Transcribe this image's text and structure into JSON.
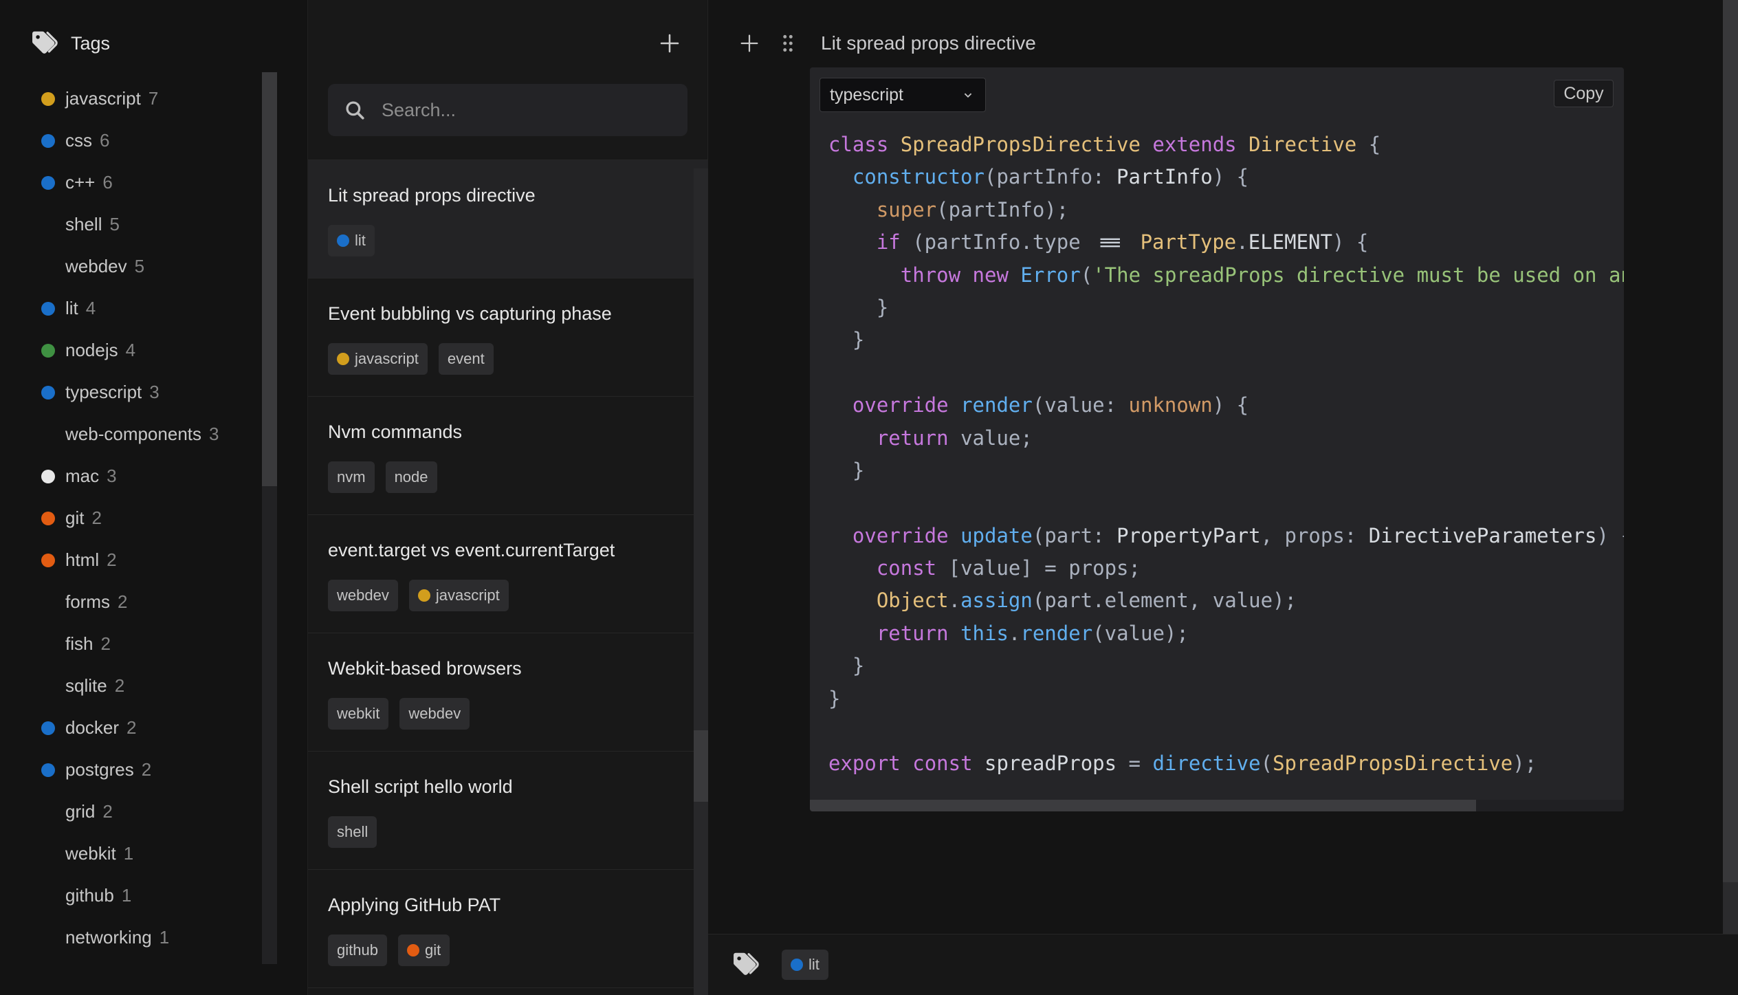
{
  "sidebar": {
    "title": "Tags",
    "tags": [
      {
        "label": "javascript",
        "count": "7",
        "dot": "yellow"
      },
      {
        "label": "css",
        "count": "6",
        "dot": "blue"
      },
      {
        "label": "c++",
        "count": "6",
        "dot": "blue"
      },
      {
        "label": "shell",
        "count": "5",
        "dot": null
      },
      {
        "label": "webdev",
        "count": "5",
        "dot": null
      },
      {
        "label": "lit",
        "count": "4",
        "dot": "blue"
      },
      {
        "label": "nodejs",
        "count": "4",
        "dot": "green"
      },
      {
        "label": "typescript",
        "count": "3",
        "dot": "blue"
      },
      {
        "label": "web-components",
        "count": "3",
        "dot": null
      },
      {
        "label": "mac",
        "count": "3",
        "dot": "white"
      },
      {
        "label": "git",
        "count": "2",
        "dot": "orange"
      },
      {
        "label": "html",
        "count": "2",
        "dot": "orange"
      },
      {
        "label": "forms",
        "count": "2",
        "dot": null
      },
      {
        "label": "fish",
        "count": "2",
        "dot": null
      },
      {
        "label": "sqlite",
        "count": "2",
        "dot": null
      },
      {
        "label": "docker",
        "count": "2",
        "dot": "blue"
      },
      {
        "label": "postgres",
        "count": "2",
        "dot": "blue"
      },
      {
        "label": "grid",
        "count": "2",
        "dot": null
      },
      {
        "label": "webkit",
        "count": "1",
        "dot": null
      },
      {
        "label": "github",
        "count": "1",
        "dot": null
      },
      {
        "label": "networking",
        "count": "1",
        "dot": null
      }
    ]
  },
  "list": {
    "add_button": "+",
    "search_placeholder": "Search...",
    "items": [
      {
        "title": "Lit spread props directive",
        "selected": true,
        "tags": [
          {
            "label": "lit",
            "dot": "blue"
          }
        ]
      },
      {
        "title": "Event bubbling vs capturing phase",
        "selected": false,
        "tags": [
          {
            "label": "javascript",
            "dot": "yellow"
          },
          {
            "label": "event",
            "dot": null
          }
        ]
      },
      {
        "title": "Nvm commands",
        "selected": false,
        "tags": [
          {
            "label": "nvm",
            "dot": null
          },
          {
            "label": "node",
            "dot": null
          }
        ]
      },
      {
        "title": "event.target vs event.currentTarget",
        "selected": false,
        "tags": [
          {
            "label": "webdev",
            "dot": null
          },
          {
            "label": "javascript",
            "dot": "yellow"
          }
        ]
      },
      {
        "title": "Webkit-based browsers",
        "selected": false,
        "tags": [
          {
            "label": "webkit",
            "dot": null
          },
          {
            "label": "webdev",
            "dot": null
          }
        ]
      },
      {
        "title": "Shell script hello world",
        "selected": false,
        "tags": [
          {
            "label": "shell",
            "dot": null
          }
        ]
      },
      {
        "title": "Applying GitHub PAT",
        "selected": false,
        "tags": [
          {
            "label": "github",
            "dot": null
          },
          {
            "label": "git",
            "dot": "orange"
          }
        ]
      }
    ]
  },
  "editor": {
    "add_button": "+",
    "title": "Lit spread props directive",
    "language": "typescript",
    "copy_label": "Copy",
    "footer_tags": [
      {
        "label": "lit",
        "dot": "blue"
      }
    ],
    "code_lines": [
      [
        [
          "kw",
          "class "
        ],
        [
          "ty",
          "SpreadPropsDirective"
        ],
        [
          "kw",
          " extends "
        ],
        [
          "ty",
          "Directive"
        ],
        [
          "tx",
          " {"
        ]
      ],
      [
        [
          "tx",
          "  "
        ],
        [
          "fn",
          "constructor"
        ],
        [
          "tx",
          "(partInfo: "
        ],
        [
          "br",
          "PartInfo"
        ],
        [
          "tx",
          ") {"
        ]
      ],
      [
        [
          "tx",
          "    "
        ],
        [
          "or",
          "super"
        ],
        [
          "tx",
          "(partInfo);"
        ]
      ],
      [
        [
          "tx",
          "    "
        ],
        [
          "kw",
          "if"
        ],
        [
          "tx",
          " (partInfo.type "
        ],
        [
          "lig",
          "==="
        ],
        [
          "tx",
          " "
        ],
        [
          "ty",
          "PartType"
        ],
        [
          "tx",
          "."
        ],
        [
          "br",
          "ELEMENT"
        ],
        [
          "tx",
          ") {"
        ]
      ],
      [
        [
          "tx",
          "      "
        ],
        [
          "kw",
          "throw"
        ],
        [
          "tx",
          " "
        ],
        [
          "kw",
          "new"
        ],
        [
          "tx",
          " "
        ],
        [
          "fn",
          "Error"
        ],
        [
          "tx",
          "("
        ],
        [
          "st",
          "'The spreadProps directive must be used on an element'"
        ],
        [
          "tx",
          ");"
        ]
      ],
      [
        [
          "tx",
          "    }"
        ]
      ],
      [
        [
          "tx",
          "  }"
        ]
      ],
      [],
      [
        [
          "tx",
          "  "
        ],
        [
          "kw",
          "override"
        ],
        [
          "tx",
          " "
        ],
        [
          "fn",
          "render"
        ],
        [
          "tx",
          "(value: "
        ],
        [
          "or",
          "unknown"
        ],
        [
          "tx",
          ") {"
        ]
      ],
      [
        [
          "tx",
          "    "
        ],
        [
          "kw",
          "return"
        ],
        [
          "tx",
          " value;"
        ]
      ],
      [
        [
          "tx",
          "  }"
        ]
      ],
      [],
      [
        [
          "tx",
          "  "
        ],
        [
          "kw",
          "override"
        ],
        [
          "tx",
          " "
        ],
        [
          "fn",
          "update"
        ],
        [
          "tx",
          "(part: "
        ],
        [
          "br",
          "PropertyPart"
        ],
        [
          "tx",
          ", props: "
        ],
        [
          "br",
          "DirectiveParameters"
        ],
        [
          "tx",
          ") {"
        ]
      ],
      [
        [
          "tx",
          "    "
        ],
        [
          "kw",
          "const"
        ],
        [
          "tx",
          " [value] = props;"
        ]
      ],
      [
        [
          "tx",
          "    "
        ],
        [
          "ty",
          "Object"
        ],
        [
          "tx",
          "."
        ],
        [
          "fn",
          "assign"
        ],
        [
          "tx",
          "(part.element, value);"
        ]
      ],
      [
        [
          "tx",
          "    "
        ],
        [
          "kw",
          "return"
        ],
        [
          "tx",
          " "
        ],
        [
          "fn",
          "this"
        ],
        [
          "tx",
          "."
        ],
        [
          "fn",
          "render"
        ],
        [
          "tx",
          "(value);"
        ]
      ],
      [
        [
          "tx",
          "  }"
        ]
      ],
      [
        [
          "tx",
          "}"
        ]
      ],
      [],
      [
        [
          "kw",
          "export"
        ],
        [
          "tx",
          " "
        ],
        [
          "kw",
          "const"
        ],
        [
          "tx",
          " "
        ],
        [
          "br",
          "spreadProps"
        ],
        [
          "tx",
          " = "
        ],
        [
          "fn",
          "directive"
        ],
        [
          "tx",
          "("
        ],
        [
          "ty",
          "SpreadPropsDirective"
        ],
        [
          "tx",
          ");"
        ]
      ]
    ]
  },
  "colors": {
    "yellow": "#d29e1d",
    "blue": "#1a6fc9",
    "green": "#3f9142",
    "orange": "#e25c12",
    "white": "#e8e8e8"
  },
  "syntax_colors": {
    "keyword": "#c678dd",
    "function": "#61afef",
    "type": "#e5c07b",
    "builtin": "#d19a66",
    "string": "#98c379",
    "default": "#abb2bf",
    "bright": "#d7dbe0"
  },
  "icons": [
    "tags-icon",
    "plus-icon",
    "search-icon",
    "drag-handle-icon",
    "chevron-down-icon"
  ]
}
